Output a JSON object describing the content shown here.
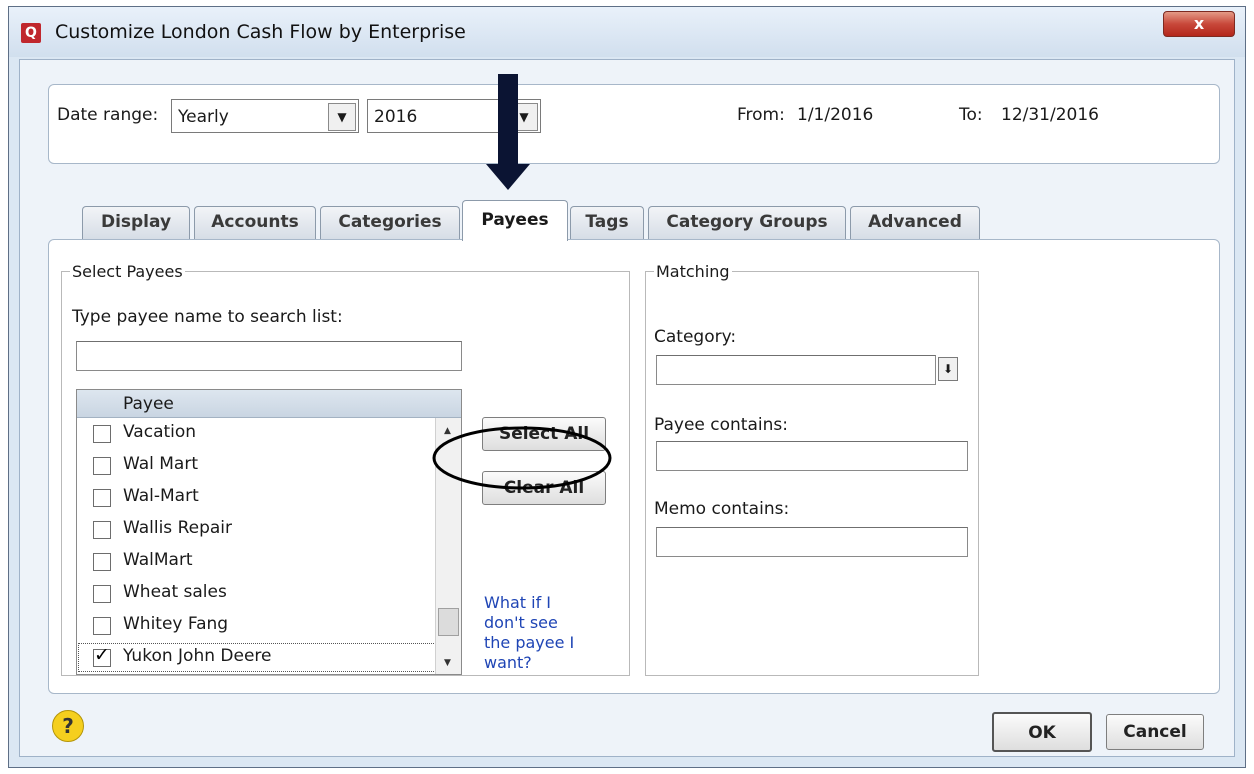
{
  "window": {
    "title": "Customize London Cash Flow by Enterprise",
    "app_icon_glyph": "Q",
    "close_glyph": "x"
  },
  "date": {
    "range_label": "Date range:",
    "range_value": "Yearly",
    "year_value": "2016",
    "from_label": "From:",
    "from_value": "1/1/2016",
    "to_label": "To:",
    "to_value": "12/31/2016"
  },
  "tabs": [
    "Display",
    "Accounts",
    "Categories",
    "Payees",
    "Tags",
    "Category Groups",
    "Advanced"
  ],
  "active_tab": "Payees",
  "select_payees": {
    "group_label": "Select Payees",
    "search_label": "Type payee name to search list:",
    "search_value": "",
    "column_header": "Payee",
    "items": [
      {
        "name": "Vacation",
        "checked": false
      },
      {
        "name": "Wal Mart",
        "checked": false
      },
      {
        "name": "Wal-Mart",
        "checked": false
      },
      {
        "name": "Wallis Repair",
        "checked": false
      },
      {
        "name": "WalMart",
        "checked": false
      },
      {
        "name": "Wheat sales",
        "checked": false
      },
      {
        "name": "Whitey Fang",
        "checked": false
      },
      {
        "name": "Yukon John Deere",
        "checked": true
      }
    ],
    "select_all_label": "Select All",
    "clear_all_label": "Clear All",
    "help_link": [
      "What if I",
      "don't see",
      "the payee I",
      "want?"
    ]
  },
  "matching": {
    "group_label": "Matching",
    "category_label": "Category:",
    "category_value": "",
    "payee_contains_label": "Payee contains:",
    "payee_contains_value": "",
    "memo_contains_label": "Memo contains:",
    "memo_contains_value": ""
  },
  "footer": {
    "help_glyph": "?",
    "ok_label": "OK",
    "cancel_label": "Cancel"
  },
  "colors": {
    "accent_title": "#dbe7f3",
    "close_button": "#c8483a",
    "link": "#1f45b5",
    "annotation": "#0b1433",
    "help_icon": "#f5cf1e"
  }
}
